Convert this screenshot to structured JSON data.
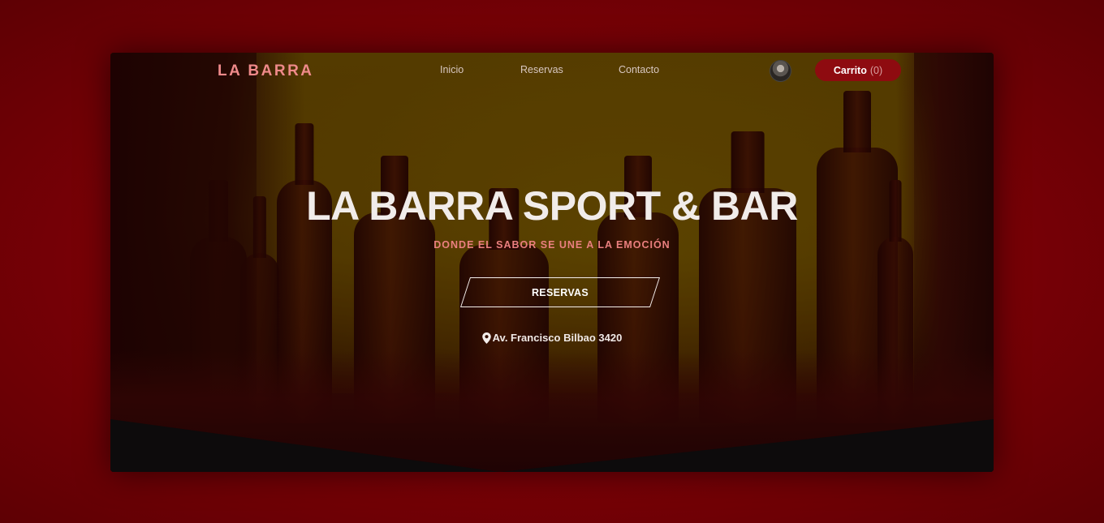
{
  "nav": {
    "logo": "LA BARRA",
    "links": [
      "Inicio",
      "Reservas",
      "Contacto"
    ],
    "cart_label": "Carrito",
    "cart_count": "(0)",
    "avatar_icon": "user-avatar"
  },
  "hero": {
    "title": "LA BARRA SPORT & BAR",
    "subtitle": "DONDE EL SABOR SE UNE A LA EMOCIÓN",
    "cta_label": "RESERVAS",
    "address": "Av. Francisco Bilbao 3420",
    "address_icon": "map-pin-icon"
  },
  "colors": {
    "page_bg": "#7a0006",
    "accent": "#8e0b10",
    "logo": "#ef8a8a",
    "subtitle": "#ea7f7f"
  }
}
